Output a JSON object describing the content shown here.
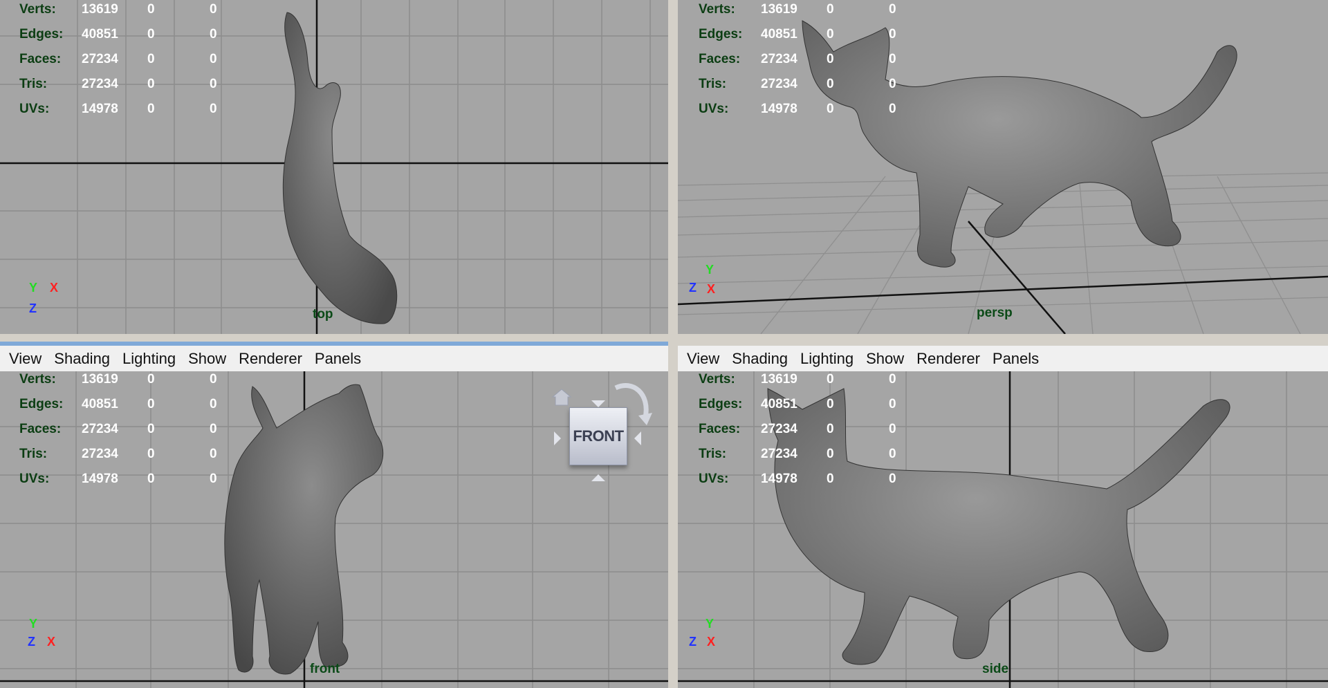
{
  "menu": [
    "View",
    "Shading",
    "Lighting",
    "Show",
    "Renderer",
    "Panels"
  ],
  "hud": {
    "labels": [
      "Verts:",
      "Edges:",
      "Faces:",
      "Tris:",
      "UVs:"
    ],
    "values": [
      [
        "13619",
        "0",
        "0"
      ],
      [
        "40851",
        "0",
        "0"
      ],
      [
        "27234",
        "0",
        "0"
      ],
      [
        "27234",
        "0",
        "0"
      ],
      [
        "14978",
        "0",
        "0"
      ]
    ]
  },
  "viewports": {
    "top": {
      "camera": "top",
      "axis": [
        "Y",
        "X",
        "Z"
      ]
    },
    "persp": {
      "camera": "persp",
      "axis": [
        "Y",
        "Z",
        "X"
      ]
    },
    "front": {
      "camera": "front",
      "axis": [
        "Y",
        "Z",
        "X"
      ]
    },
    "side": {
      "camera": "side",
      "axis": [
        "Y",
        "Z",
        "X"
      ]
    }
  },
  "viewcube": {
    "face": "FRONT",
    "icons": [
      "home-icon",
      "rotate-arrow-icon"
    ]
  },
  "colors": {
    "viewport_bg": "#a5a5a5",
    "hud_label": "#0b3d12",
    "hud_value": "#ffffff",
    "axis_x": "#ff2020",
    "axis_y": "#22dd22",
    "axis_z": "#2233ff",
    "active_border": "#7fa9d8"
  }
}
